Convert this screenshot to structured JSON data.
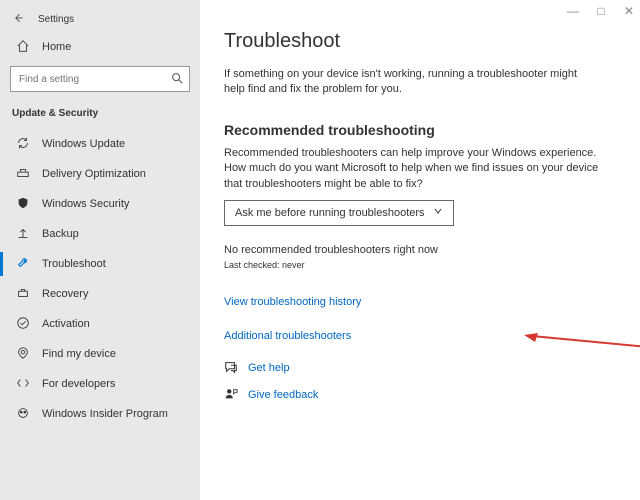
{
  "window": {
    "title": "Settings"
  },
  "sidebar": {
    "home": "Home",
    "search_placeholder": "Find a setting",
    "category": "Update & Security",
    "items": [
      {
        "label": "Windows Update"
      },
      {
        "label": "Delivery Optimization"
      },
      {
        "label": "Windows Security"
      },
      {
        "label": "Backup"
      },
      {
        "label": "Troubleshoot"
      },
      {
        "label": "Recovery"
      },
      {
        "label": "Activation"
      },
      {
        "label": "Find my device"
      },
      {
        "label": "For developers"
      },
      {
        "label": "Windows Insider Program"
      }
    ]
  },
  "main": {
    "title": "Troubleshoot",
    "intro": "If something on your device isn't working, running a troubleshooter might help find and fix the problem for you.",
    "rec_heading": "Recommended troubleshooting",
    "rec_text": "Recommended troubleshooters can help improve your Windows experience. How much do you want Microsoft to help when we find issues on your device that troubleshooters might be able to fix?",
    "dropdown_value": "Ask me before running troubleshooters",
    "no_rec": "No recommended troubleshooters right now",
    "last_checked": "Last checked: never",
    "history_link": "View troubleshooting history",
    "additional_link": "Additional troubleshooters",
    "get_help": "Get help",
    "give_feedback": "Give feedback"
  }
}
